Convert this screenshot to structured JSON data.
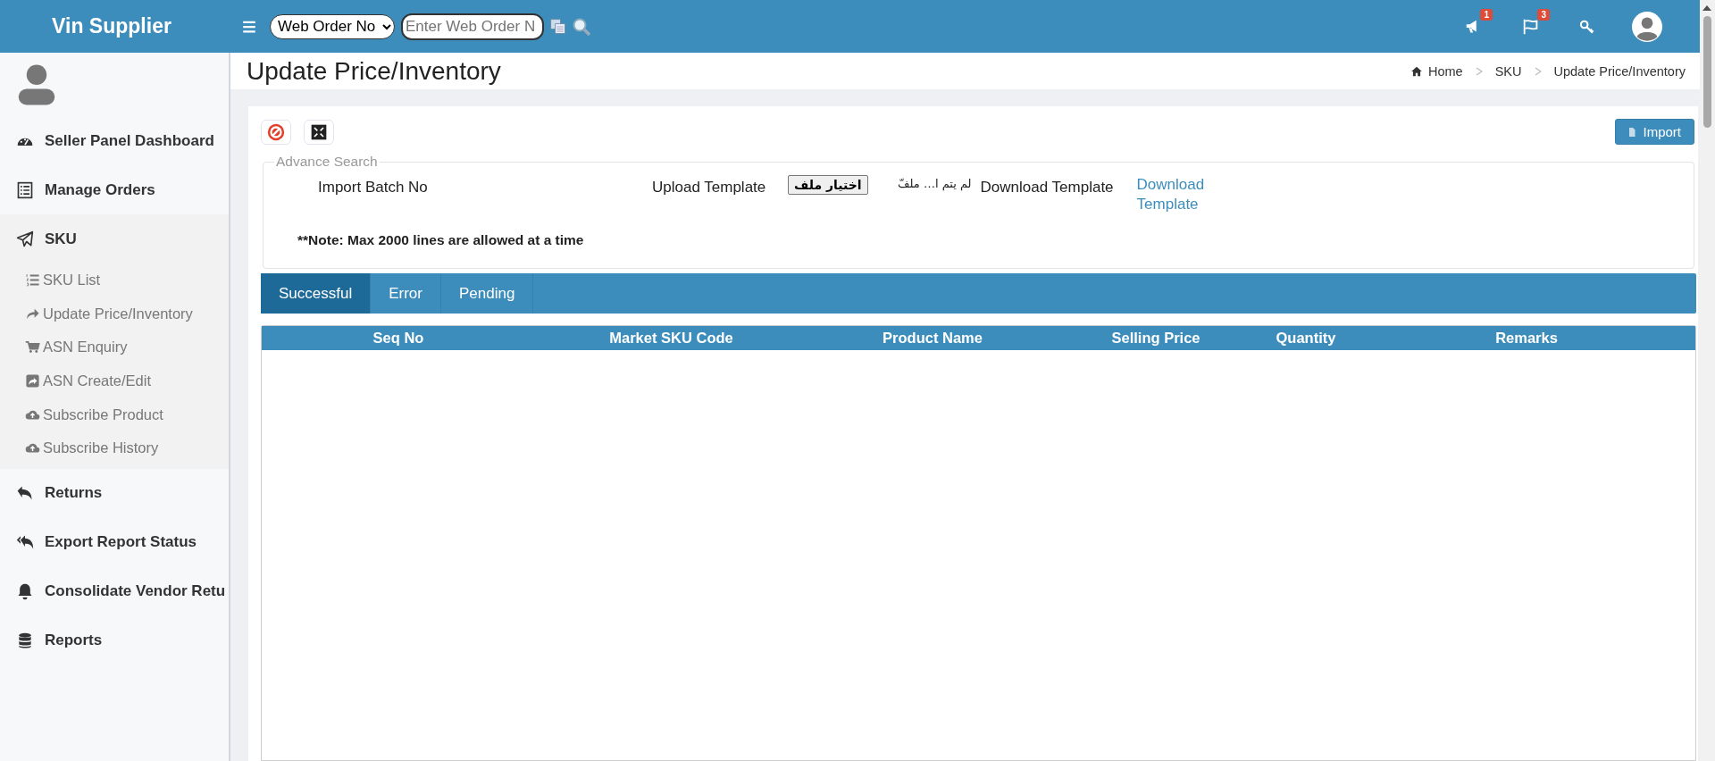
{
  "topbar": {
    "brand": "Vin Supplier",
    "search_type": "Web Order No",
    "search_placeholder": "Enter Web Order N",
    "badges": [
      "1",
      "3"
    ]
  },
  "sidebar": {
    "items": [
      {
        "label": "Seller Panel Dashboard",
        "expanded": false
      },
      {
        "label": "Manage Orders",
        "expanded": false
      },
      {
        "label": "SKU",
        "expanded": true,
        "children": [
          {
            "label": "SKU List"
          },
          {
            "label": "Update Price/Inventory"
          },
          {
            "label": "ASN Enquiry"
          },
          {
            "label": "ASN Create/Edit"
          },
          {
            "label": "Subscribe Product"
          },
          {
            "label": "Subscribe History"
          }
        ]
      },
      {
        "label": "Returns",
        "expanded": false
      },
      {
        "label": "Export Report Status",
        "expanded": false
      },
      {
        "label": "Consolidate Vendor Retu",
        "expanded": false
      },
      {
        "label": "Reports",
        "expanded": false
      }
    ]
  },
  "page": {
    "title": "Update Price/Inventory",
    "breadcrumb": [
      "Home",
      "SKU",
      "Update Price/Inventory"
    ]
  },
  "import_button": "Import",
  "advance_search": {
    "legend": "Advance Search",
    "batch_label": "Import Batch No",
    "upload_label": "Upload Template",
    "file_button": "اختيار ملف",
    "file_status": "لم يتم ا… ملفّ",
    "download_label": "Download Template",
    "download_link": "Download Template",
    "note": "**Note: Max 2000 lines are allowed at a time"
  },
  "tabs": [
    {
      "label": "Successful",
      "selected": true
    },
    {
      "label": "Error",
      "selected": false
    },
    {
      "label": "Pending",
      "selected": false
    }
  ],
  "table": {
    "columns": [
      "Seq No",
      "Market SKU Code",
      "Product Name",
      "Selling Price",
      "Quantity",
      "Remarks"
    ]
  }
}
